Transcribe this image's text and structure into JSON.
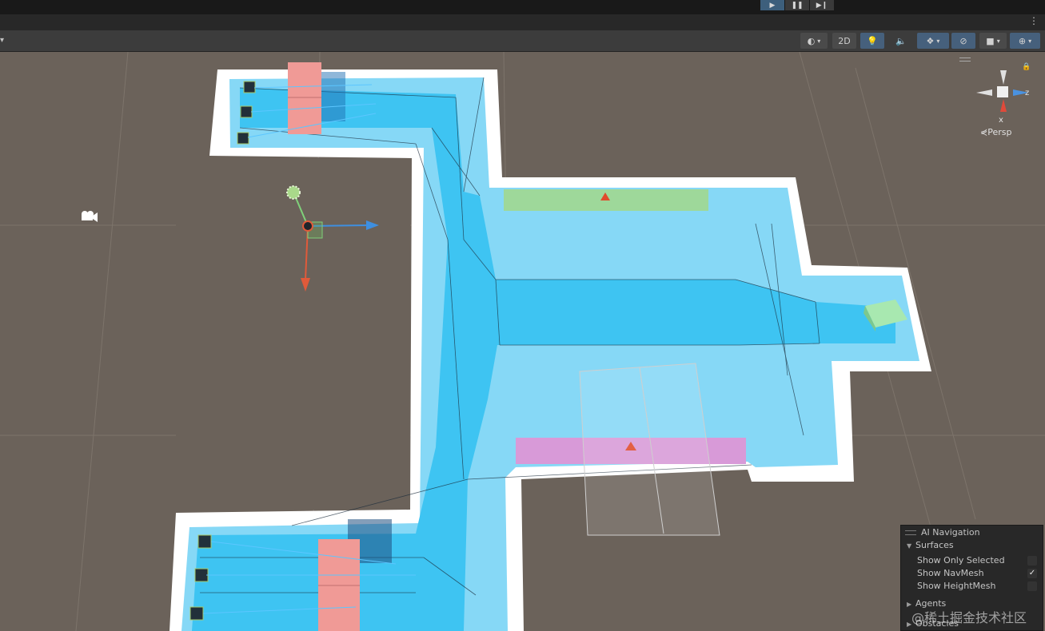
{
  "toolbar": {
    "mode_2d": "2D"
  },
  "gizmo": {
    "projection": "Persp",
    "x_label": "x",
    "z_label": "z"
  },
  "ai_navigation": {
    "title": "AI Navigation",
    "surfaces_label": "Surfaces",
    "show_only_selected": {
      "label": "Show Only Selected",
      "checked": false
    },
    "show_navmesh": {
      "label": "Show NavMesh",
      "checked": true
    },
    "show_heightmesh": {
      "label": "Show HeightMesh",
      "checked": false
    },
    "agents_label": "Agents",
    "obstacles_label": "Obstacles"
  },
  "icons": [
    "play-icon",
    "pause-icon",
    "step-icon",
    "shading-mode-icon",
    "light-icon",
    "audio-icon",
    "effects-icon",
    "visibility-icon",
    "camera-icon",
    "gizmos-icon",
    "kebab-menu-icon",
    "camera-object-icon",
    "light-object-icon",
    "lock-icon"
  ],
  "watermark": "@稀土掘金技术社区",
  "colors": {
    "navmesh": "#3ec4f2",
    "navmesh_light": "#86d8f6",
    "floor_border": "#ffffff",
    "scene_bg": "#6b625a",
    "green_area": "#9ed89a",
    "pink_area": "#d89ad8",
    "cube_red": "#f09a96"
  }
}
